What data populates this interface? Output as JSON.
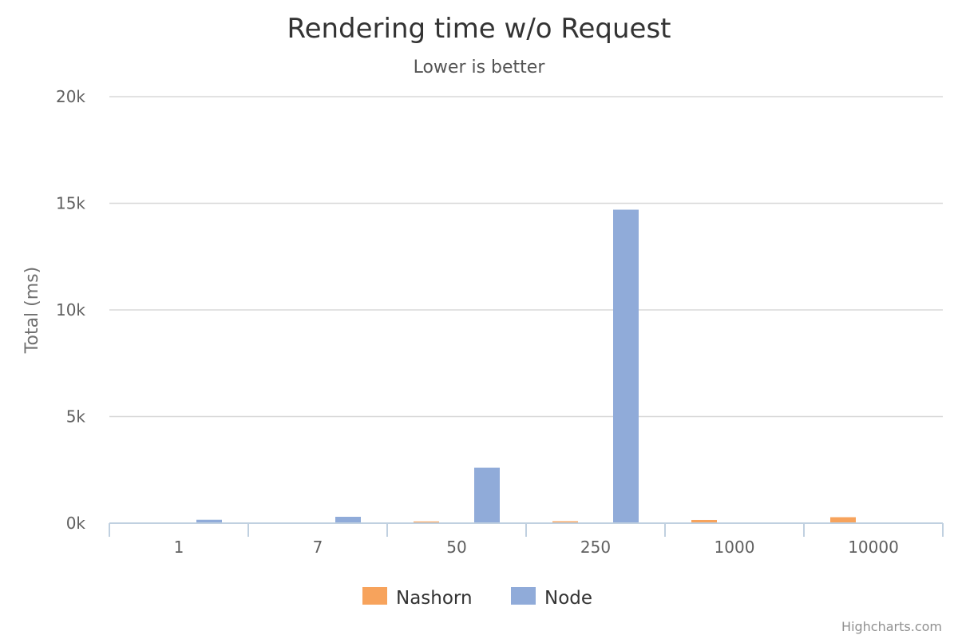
{
  "chart_data": {
    "type": "bar",
    "title": "Rendering time w/o Request",
    "subtitle": "Lower is better",
    "ylabel": "Total (ms)",
    "xlabel": "",
    "categories": [
      "1",
      "7",
      "50",
      "250",
      "1000",
      "10000"
    ],
    "series": [
      {
        "name": "Nashorn",
        "color": "#f7a35c",
        "values": [
          0,
          0,
          80,
          90,
          150,
          280
        ]
      },
      {
        "name": "Node",
        "color": "#90abd9",
        "values": [
          160,
          300,
          2600,
          14700,
          0,
          0
        ]
      }
    ],
    "ylim": [
      0,
      20000
    ],
    "yticks": [
      "0k",
      "5k",
      "10k",
      "15k",
      "20k"
    ],
    "grid": true,
    "legend_position": "bottom-center"
  },
  "credits": "Highcharts.com"
}
